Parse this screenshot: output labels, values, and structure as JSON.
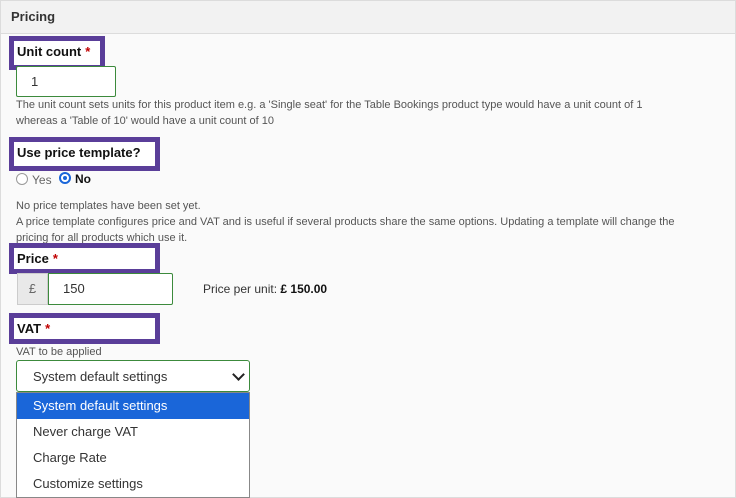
{
  "section": {
    "title": "Pricing"
  },
  "unit_count": {
    "label": "Unit count",
    "required_mark": "*",
    "value": "1",
    "help_line1": "The unit count sets units for this product item e.g. a 'Single seat' for the Table Bookings product type would have a unit count of 1",
    "help_line2": "whereas a 'Table of 10' would have a unit count of 10"
  },
  "price_template": {
    "label": "Use price template?",
    "option_yes": "Yes",
    "option_no": "No",
    "selected": "No",
    "help_line1": "No price templates have been set yet.",
    "help_line2": "A price template configures price and VAT and is useful if several products share the same options. Updating a template will change the",
    "help_line3": "pricing for all products which use it."
  },
  "price": {
    "label": "Price",
    "required_mark": "*",
    "currency_symbol": "£",
    "value": "150",
    "per_unit_label": "Price per unit:",
    "per_unit_value": "£ 150.00"
  },
  "vat": {
    "label": "VAT",
    "required_mark": "*",
    "help": "VAT to be applied",
    "selected": "System default settings",
    "options": [
      "System default settings",
      "Never charge VAT",
      "Charge Rate",
      "Customize settings"
    ]
  },
  "colors": {
    "highlight_border": "#5a3e99",
    "input_border": "#3c8a3c",
    "selected_option": "#1a66d9",
    "required": "#c00000"
  }
}
